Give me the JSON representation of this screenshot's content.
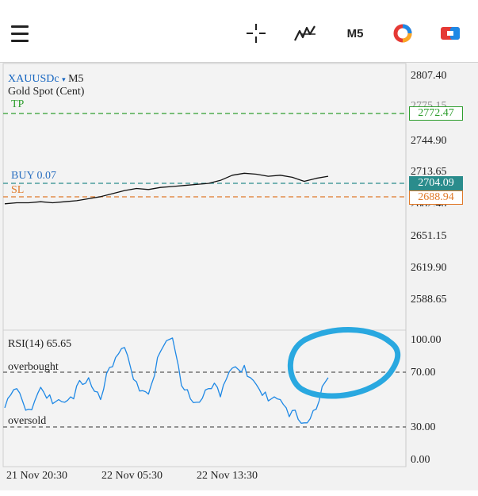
{
  "toolbar": {
    "menu_icon": "hamburger-menu-icon",
    "crosshair_icon": "crosshair-icon",
    "indicators_icon": "indicators-icon",
    "timeframe": "M5",
    "objects_icon": "objects-icon",
    "trade_icon": "trade-icon"
  },
  "chart": {
    "symbol": "XAUUSDc",
    "symbol_arrow": "▾",
    "timeframe": "M5",
    "description": "Gold Spot (Cent)",
    "tp_label": "TP",
    "buy_label": "BUY 0.07",
    "sl_label": "SL",
    "tp_price": "2772.47",
    "buy_price": "2704.09",
    "sl_price": "2688.94",
    "price_axis": [
      "2807.40",
      "2744.90",
      "2713.65",
      "2682.40",
      "2651.15",
      "2619.90",
      "2588.65"
    ],
    "price_axis_partial": "2775.15",
    "colors": {
      "tp": "#2e9e2e",
      "buy": "#2a8c8c",
      "sl": "#e07a2a",
      "price_line": "#111111",
      "rsi_line": "#1e88e5",
      "annotation": "#29a8e0"
    }
  },
  "rsi": {
    "label": "RSI(14) 65.65",
    "overbought_label": "overbought",
    "oversold_label": "oversold",
    "axis": [
      "100.00",
      "70.00",
      "30.00",
      "0.00"
    ]
  },
  "time_axis": [
    "21 Nov 20:30",
    "22 Nov 05:30",
    "22 Nov 13:30"
  ],
  "chart_data": {
    "type": "line",
    "title": "",
    "series": [
      {
        "name": "XAUUSDc",
        "values": [
          2683,
          2684,
          2684,
          2685,
          2684,
          2685,
          2686,
          2688,
          2690,
          2693,
          2696,
          2698,
          2697,
          2699,
          2700,
          2701,
          2702,
          2703,
          2706,
          2711,
          2713,
          2712,
          2710,
          2711,
          2709,
          2705,
          2708,
          2710
        ]
      },
      {
        "name": "RSI(14)",
        "values": [
          48,
          55,
          42,
          60,
          50,
          44,
          58,
          66,
          52,
          78,
          85,
          62,
          55,
          88,
          92,
          55,
          48,
          60,
          56,
          70,
          74,
          62,
          52,
          46,
          40,
          33,
          45,
          66
        ]
      }
    ],
    "price_ylim": [
      2588.65,
      2807.4
    ],
    "rsi_ylim": [
      0,
      100
    ],
    "x_ticks": [
      "21 Nov 20:30",
      "22 Nov 05:30",
      "22 Nov 13:30"
    ]
  }
}
